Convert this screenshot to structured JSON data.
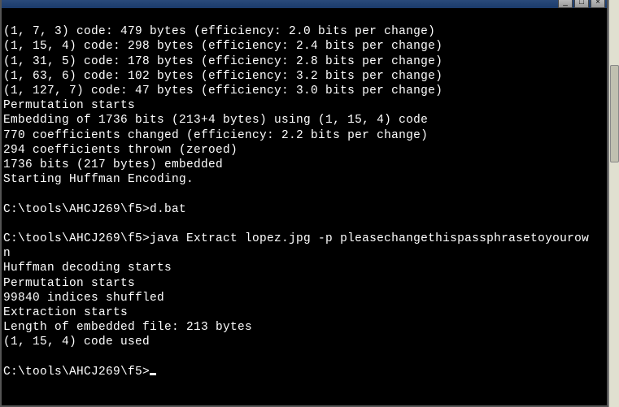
{
  "window_controls": {
    "minimize": "_",
    "maximize": "□",
    "close": "×"
  },
  "lines": [
    "(1, 7, 3) code: 479 bytes (efficiency: 2.0 bits per change)",
    "(1, 15, 4) code: 298 bytes (efficiency: 2.4 bits per change)",
    "(1, 31, 5) code: 178 bytes (efficiency: 2.8 bits per change)",
    "(1, 63, 6) code: 102 bytes (efficiency: 3.2 bits per change)",
    "(1, 127, 7) code: 47 bytes (efficiency: 3.0 bits per change)",
    "Permutation starts",
    "Embedding of 1736 bits (213+4 bytes) using (1, 15, 4) code",
    "770 coefficients changed (efficiency: 2.2 bits per change)",
    "294 coefficients thrown (zeroed)",
    "1736 bits (217 bytes) embedded",
    "Starting Huffman Encoding.",
    "",
    "C:\\tools\\AHCJ269\\f5>d.bat",
    "",
    "C:\\tools\\AHCJ269\\f5>java Extract lopez.jpg -p pleasechangethispassphrasetoyourow",
    "n",
    "Huffman decoding starts",
    "Permutation starts",
    "99840 indices shuffled",
    "Extraction starts",
    "Length of embedded file: 213 bytes",
    "(1, 15, 4) code used",
    ""
  ],
  "prompt": "C:\\tools\\AHCJ269\\f5>"
}
